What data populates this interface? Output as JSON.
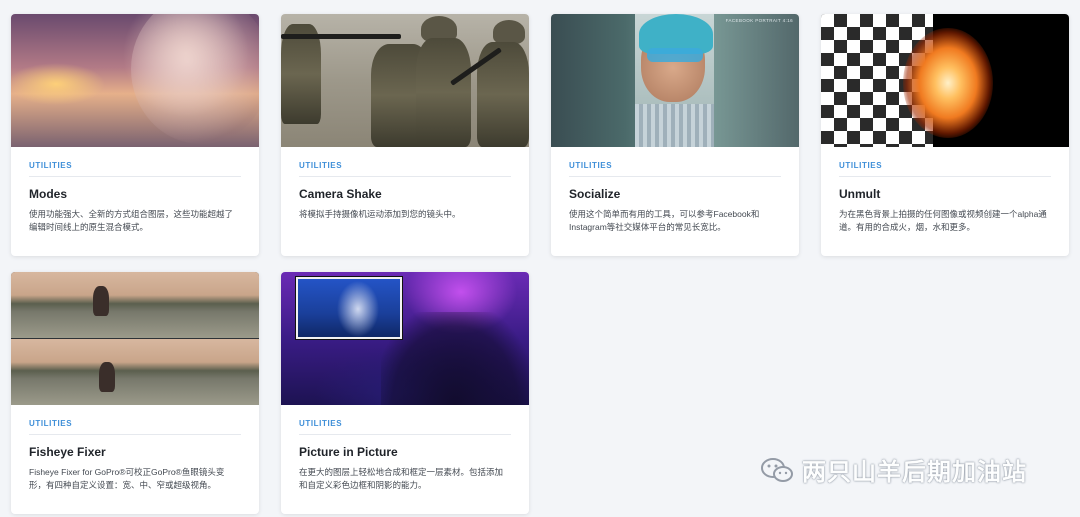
{
  "cards": [
    {
      "category": "UTILITIES",
      "title": "Modes",
      "description": "使用功能强大、全新的方式组合图层，这些功能超越了编辑时间线上的原生混合模式。"
    },
    {
      "category": "UTILITIES",
      "title": "Camera Shake",
      "description": "将模拟手持摄像机运动添加到您的镜头中。"
    },
    {
      "category": "UTILITIES",
      "title": "Socialize",
      "description": "使用这个简单而有用的工具，可以参考Facebook和Instagram等社交媒体平台的常见长宽比。",
      "thumb_label": "FACEBOOK PORTRAIT 4:16"
    },
    {
      "category": "UTILITIES",
      "title": "Unmult",
      "description": "为在黑色背景上拍摄的任何图像或视频创建一个alpha通道。有用的合成火，烟，水和更多。"
    },
    {
      "category": "UTILITIES",
      "title": "Fisheye Fixer",
      "description": "Fisheye Fixer for GoPro®可校正GoPro®鱼眼镜头变形，有四种自定义设置：宽、中、窄或超级视角。"
    },
    {
      "category": "UTILITIES",
      "title": "Picture in Picture",
      "description": "在更大的图层上轻松地合成和框定一层素材。包括添加和自定义彩色边框和阴影的能力。"
    }
  ],
  "watermark": {
    "text": "两只山羊后期加油站",
    "icon": "wechat-icon"
  }
}
